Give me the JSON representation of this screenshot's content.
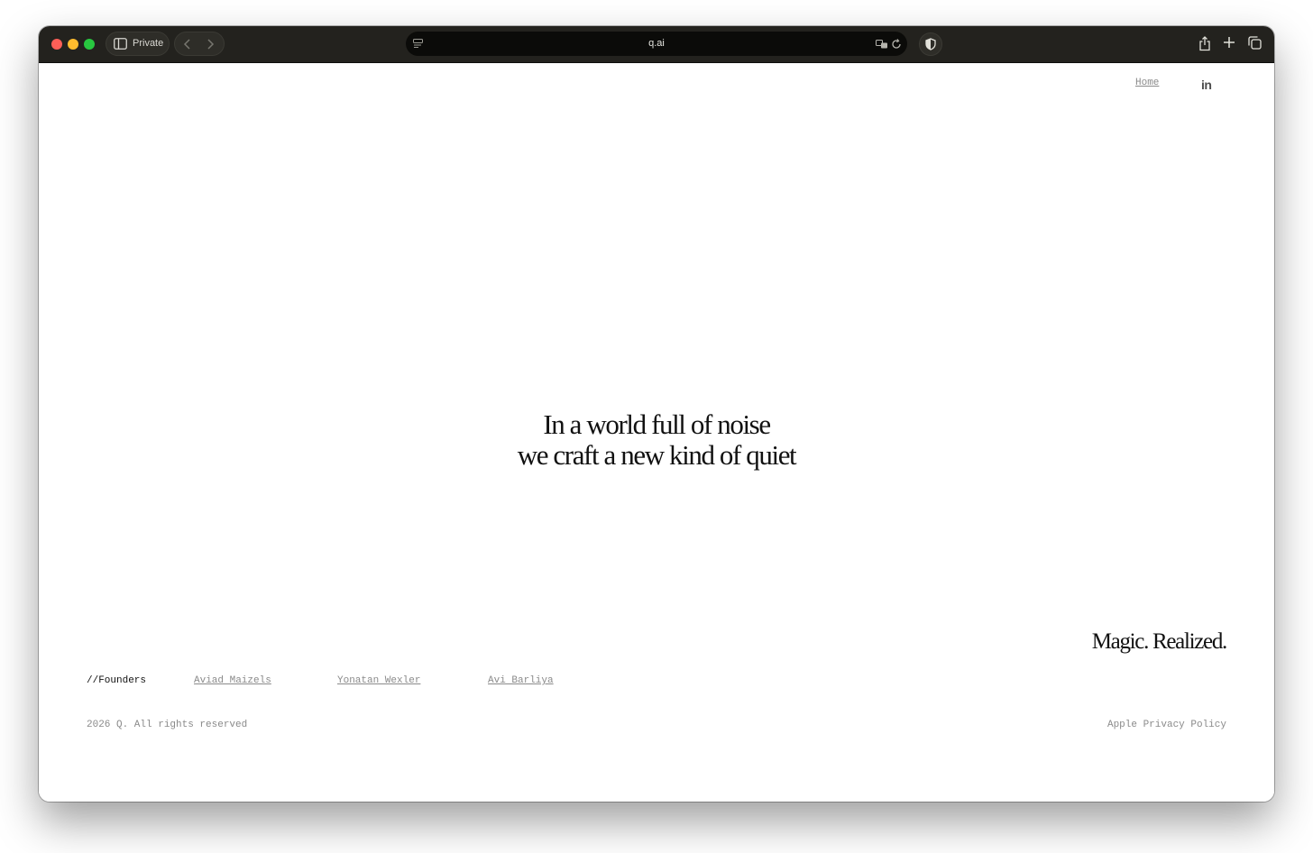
{
  "browser": {
    "private_label": "Private",
    "url": "q.ai",
    "icons": [
      "sidebar-icon",
      "back-icon",
      "forward-icon",
      "site-settings-icon",
      "translate-icon",
      "reload-icon",
      "shield-icon",
      "share-icon",
      "new-tab-icon",
      "tab-overview-icon"
    ],
    "traffic_lights": {
      "close": "#fe5f57",
      "minimize": "#febc2e",
      "zoom": "#28c840"
    }
  },
  "nav": {
    "home_label": "Home",
    "linkedin_label": "in"
  },
  "hero": {
    "line1": "In a world full of noise",
    "line2": "we craft a new kind of quiet"
  },
  "tagline": "Magic. Realized.",
  "founders": {
    "label": "//Founders",
    "names": [
      "Aviad Maizels",
      "Yonatan Wexler",
      "Avi Barliya"
    ]
  },
  "footer": {
    "copyright": "2026 Q. All rights reserved",
    "privacy_label": "Apple Privacy Policy"
  }
}
